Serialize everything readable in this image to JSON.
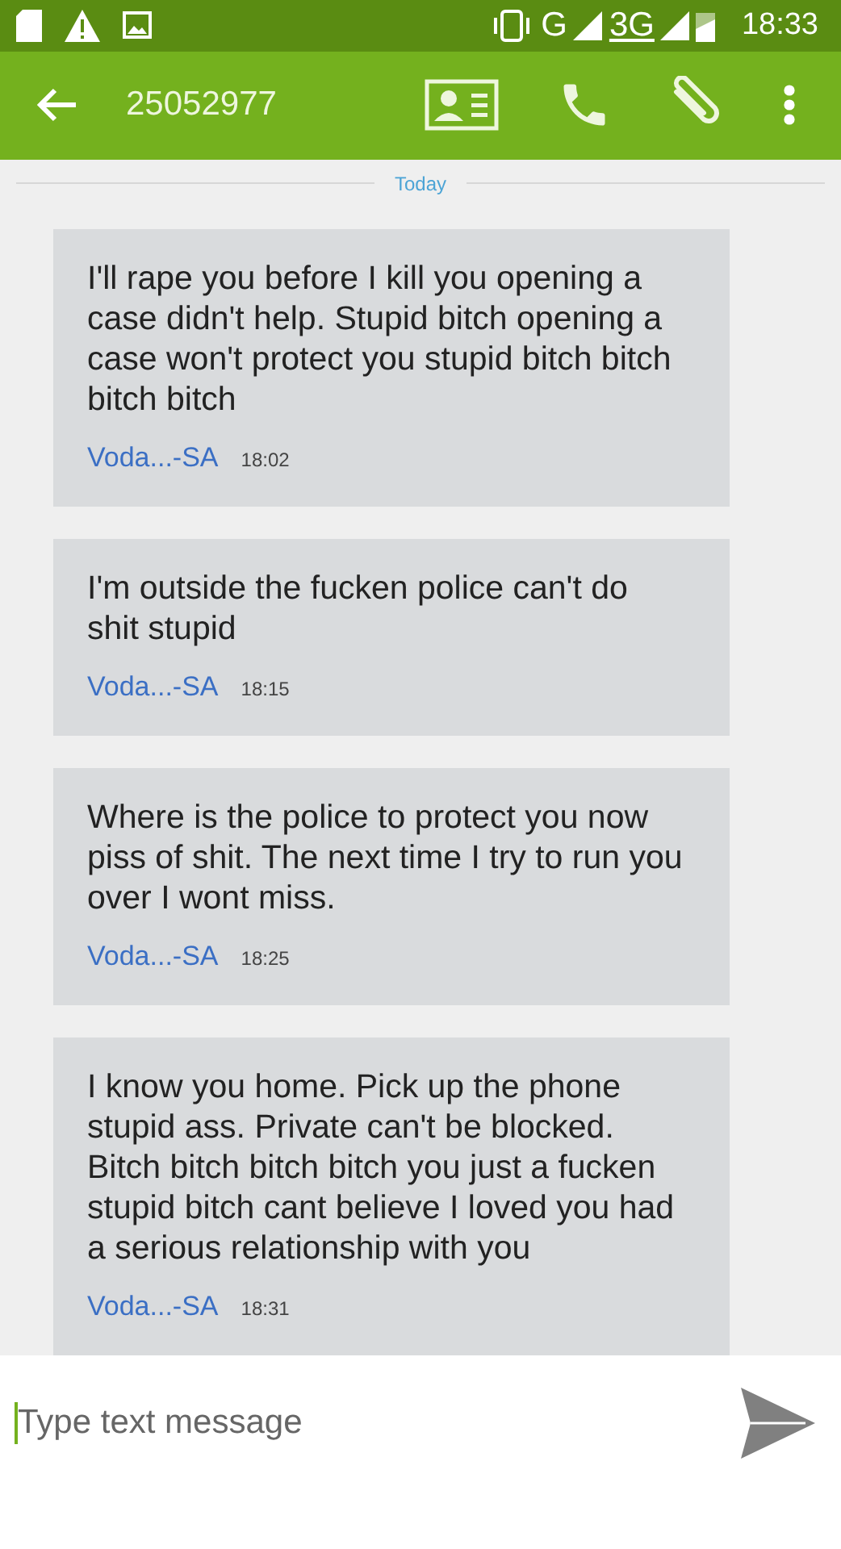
{
  "status_bar": {
    "network_g": "G",
    "network_3g": "3G",
    "time": "18:33"
  },
  "header": {
    "title": "25052977"
  },
  "date_divider": "Today",
  "messages": [
    {
      "text": "I'll rape you before I kill you opening a case didn't help. Stupid bitch opening a case won't protect you stupid bitch bitch bitch bitch",
      "sender": "Voda...-SA",
      "time": "18:02"
    },
    {
      "text": "I'm outside the fucken police can't do shit stupid",
      "sender": "Voda...-SA",
      "time": "18:15"
    },
    {
      "text": "Where is the police to protect you now piss of shit. The next time I try to run you over I wont miss.",
      "sender": "Voda...-SA",
      "time": "18:25"
    },
    {
      "text": "I know you home. Pick up the phone stupid ass. Private can't be blocked. Bitch bitch bitch bitch you just a fucken stupid bitch cant believe I loved you had a serious relationship with you",
      "sender": "Voda...-SA",
      "time": "18:31"
    }
  ],
  "composer": {
    "placeholder": "Type text message"
  }
}
